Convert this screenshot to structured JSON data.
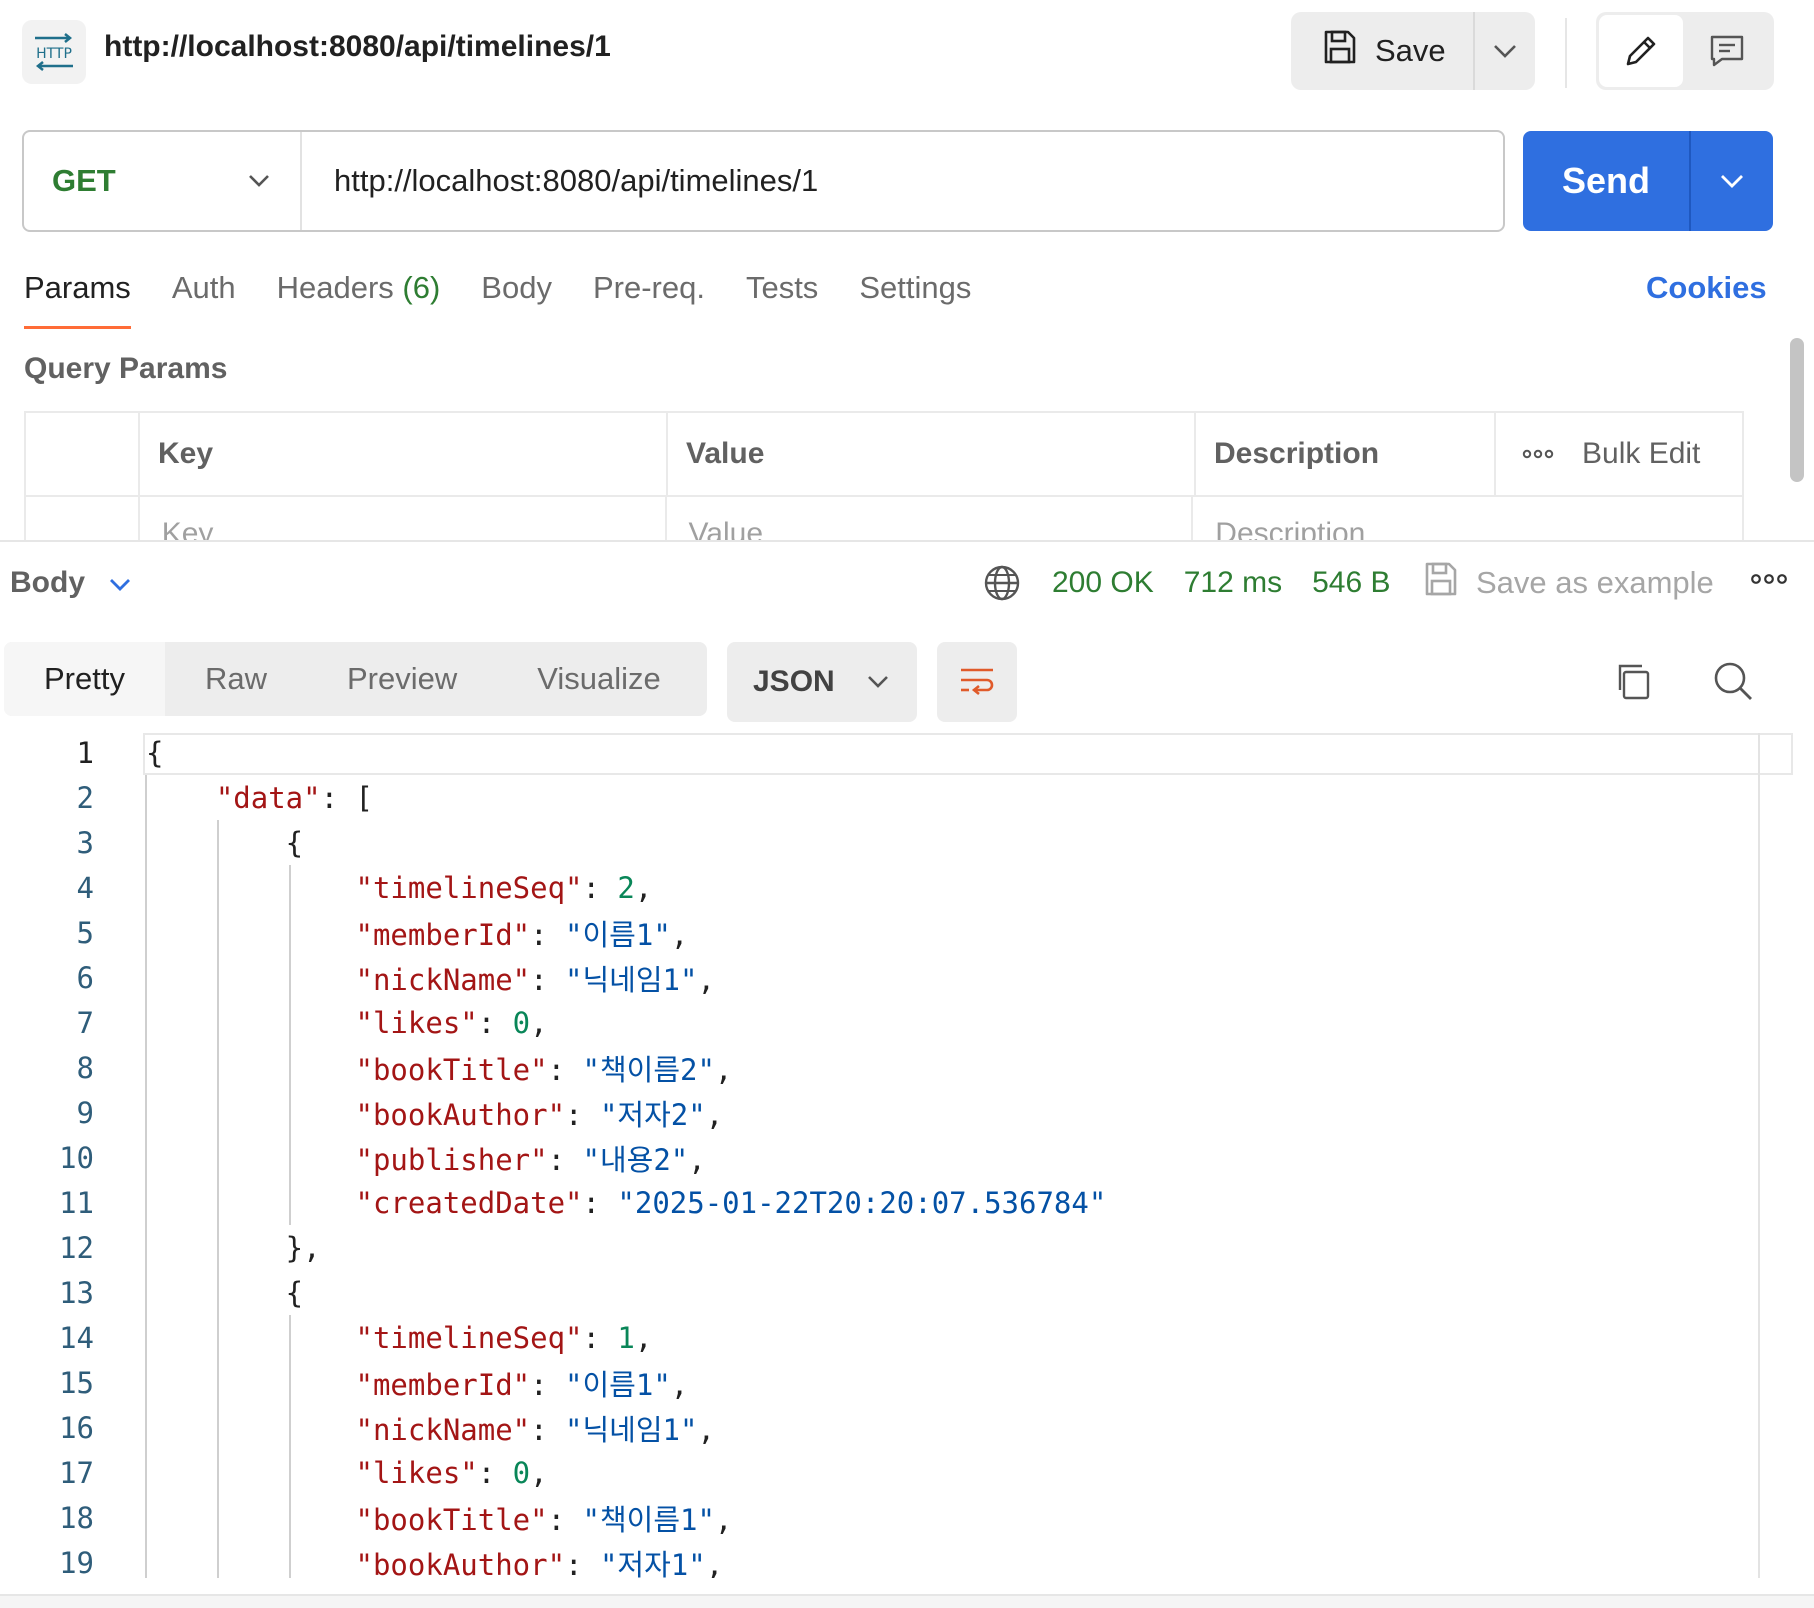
{
  "request": {
    "title": "http://localhost:8080/api/timelines/1",
    "method": "GET",
    "url": "http://localhost:8080/api/timelines/1",
    "badge": "HTTP"
  },
  "toolbar": {
    "save_label": "Save",
    "send_label": "Send"
  },
  "req_tabs": [
    {
      "label": "Params",
      "count": ""
    },
    {
      "label": "Auth",
      "count": ""
    },
    {
      "label": "Headers",
      "count": "(6)"
    },
    {
      "label": "Body",
      "count": ""
    },
    {
      "label": "Pre-req.",
      "count": ""
    },
    {
      "label": "Tests",
      "count": ""
    },
    {
      "label": "Settings",
      "count": ""
    }
  ],
  "cookies_label": "Cookies",
  "query_params": {
    "title": "Query Params",
    "headers": {
      "key": "Key",
      "value": "Value",
      "description": "Description",
      "bulk_edit": "Bulk Edit"
    },
    "placeholders": {
      "key": "Key",
      "value": "Value",
      "description": "Description"
    }
  },
  "response": {
    "body_label": "Body",
    "status": "200 OK",
    "time": "712 ms",
    "size": "546 B",
    "save_example": "Save as example",
    "view_tabs": [
      "Pretty",
      "Raw",
      "Preview",
      "Visualize"
    ],
    "format": "JSON"
  },
  "code_lines": [
    [
      [
        "p",
        "{"
      ]
    ],
    [
      [
        "p",
        "    "
      ],
      [
        "k",
        "\"data\""
      ],
      [
        "p",
        ": ["
      ]
    ],
    [
      [
        "p",
        "        {"
      ]
    ],
    [
      [
        "p",
        "            "
      ],
      [
        "k",
        "\"timelineSeq\""
      ],
      [
        "p",
        ": "
      ],
      [
        "n",
        "2"
      ],
      [
        "p",
        ","
      ]
    ],
    [
      [
        "p",
        "            "
      ],
      [
        "k",
        "\"memberId\""
      ],
      [
        "p",
        ": "
      ],
      [
        "s",
        "\"이름1\""
      ],
      [
        "p",
        ","
      ]
    ],
    [
      [
        "p",
        "            "
      ],
      [
        "k",
        "\"nickName\""
      ],
      [
        "p",
        ": "
      ],
      [
        "s",
        "\"닉네임1\""
      ],
      [
        "p",
        ","
      ]
    ],
    [
      [
        "p",
        "            "
      ],
      [
        "k",
        "\"likes\""
      ],
      [
        "p",
        ": "
      ],
      [
        "n",
        "0"
      ],
      [
        "p",
        ","
      ]
    ],
    [
      [
        "p",
        "            "
      ],
      [
        "k",
        "\"bookTitle\""
      ],
      [
        "p",
        ": "
      ],
      [
        "s",
        "\"책이름2\""
      ],
      [
        "p",
        ","
      ]
    ],
    [
      [
        "p",
        "            "
      ],
      [
        "k",
        "\"bookAuthor\""
      ],
      [
        "p",
        ": "
      ],
      [
        "s",
        "\"저자2\""
      ],
      [
        "p",
        ","
      ]
    ],
    [
      [
        "p",
        "            "
      ],
      [
        "k",
        "\"publisher\""
      ],
      [
        "p",
        ": "
      ],
      [
        "s",
        "\"내용2\""
      ],
      [
        "p",
        ","
      ]
    ],
    [
      [
        "p",
        "            "
      ],
      [
        "k",
        "\"createdDate\""
      ],
      [
        "p",
        ": "
      ],
      [
        "s",
        "\"2025-01-22T20:20:07.536784\""
      ]
    ],
    [
      [
        "p",
        "        },"
      ]
    ],
    [
      [
        "p",
        "        {"
      ]
    ],
    [
      [
        "p",
        "            "
      ],
      [
        "k",
        "\"timelineSeq\""
      ],
      [
        "p",
        ": "
      ],
      [
        "n",
        "1"
      ],
      [
        "p",
        ","
      ]
    ],
    [
      [
        "p",
        "            "
      ],
      [
        "k",
        "\"memberId\""
      ],
      [
        "p",
        ": "
      ],
      [
        "s",
        "\"이름1\""
      ],
      [
        "p",
        ","
      ]
    ],
    [
      [
        "p",
        "            "
      ],
      [
        "k",
        "\"nickName\""
      ],
      [
        "p",
        ": "
      ],
      [
        "s",
        "\"닉네임1\""
      ],
      [
        "p",
        ","
      ]
    ],
    [
      [
        "p",
        "            "
      ],
      [
        "k",
        "\"likes\""
      ],
      [
        "p",
        ": "
      ],
      [
        "n",
        "0"
      ],
      [
        "p",
        ","
      ]
    ],
    [
      [
        "p",
        "            "
      ],
      [
        "k",
        "\"bookTitle\""
      ],
      [
        "p",
        ": "
      ],
      [
        "s",
        "\"책이름1\""
      ],
      [
        "p",
        ","
      ]
    ],
    [
      [
        "p",
        "            "
      ],
      [
        "k",
        "\"bookAuthor\""
      ],
      [
        "p",
        ": "
      ],
      [
        "s",
        "\"저자1\""
      ],
      [
        "p",
        ","
      ]
    ]
  ],
  "colors": {
    "accent": "#2f6fe0",
    "method": "#2e7d32",
    "active_tab": "#ff6c37",
    "status": "#2e7d32"
  }
}
